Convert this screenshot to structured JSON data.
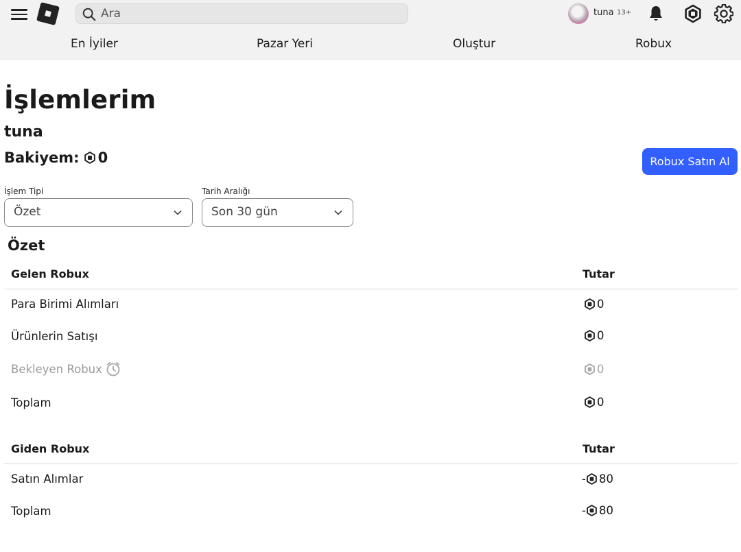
{
  "header": {
    "search_placeholder": "Ara",
    "username": "tuna",
    "age_badge": "13+",
    "icons": [
      "menu-icon",
      "roblox-logo-icon",
      "search-icon",
      "bell-icon",
      "robux-icon",
      "gear-icon"
    ]
  },
  "nav": {
    "items": [
      {
        "label": "En İyiler"
      },
      {
        "label": "Pazar Yeri"
      },
      {
        "label": "Oluştur"
      },
      {
        "label": "Robux"
      }
    ]
  },
  "page": {
    "title": "İşlemlerim",
    "username": "tuna",
    "balance_label": "Bakiyem:",
    "balance_value": "0",
    "buy_button": "Robux Satın Al"
  },
  "filters": {
    "type_label": "İşlem Tipi",
    "type_value": "Özet",
    "range_label": "Tarih Aralığı",
    "range_value": "Son 30 gün"
  },
  "summary": {
    "title": "Özet",
    "incoming": {
      "header": "Gelen Robux",
      "amount_header": "Tutar",
      "rows": [
        {
          "label": "Para Birimi Alımları",
          "amount": "0"
        },
        {
          "label": "Ürünlerin Satışı",
          "amount": "0"
        },
        {
          "label": "Bekleyen Robux",
          "amount": "0",
          "pending": true
        },
        {
          "label": "Toplam",
          "amount": "0"
        }
      ]
    },
    "outgoing": {
      "header": "Giden Robux",
      "amount_header": "Tutar",
      "rows": [
        {
          "label": "Satın Alımlar",
          "amount": "80",
          "sign": "-"
        },
        {
          "label": "Toplam",
          "amount": "80",
          "sign": "-"
        }
      ]
    }
  },
  "colors": {
    "accent": "#335fff",
    "header_bg": "#f2f2f2",
    "muted_text": "#9a9a9a"
  }
}
